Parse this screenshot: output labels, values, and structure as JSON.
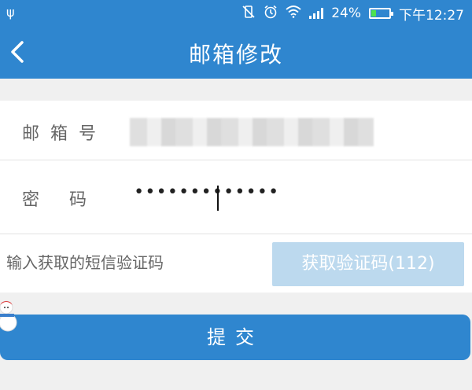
{
  "status_bar": {
    "usb_glyph": "ψ",
    "battery_percent": "24%",
    "time": "下午12:27"
  },
  "header": {
    "title": "邮箱修改"
  },
  "form": {
    "email_label": "邮箱号",
    "password_label": "密码",
    "password_value": "•••••••••••••",
    "code_placeholder": "输入获取的短信验证码",
    "get_code_button": "获取验证码(112)"
  },
  "submit_label": "提交",
  "colors": {
    "primary": "#2f86cf",
    "disabled_button": "#bcd9ee",
    "battery_green": "#4ee24e"
  }
}
